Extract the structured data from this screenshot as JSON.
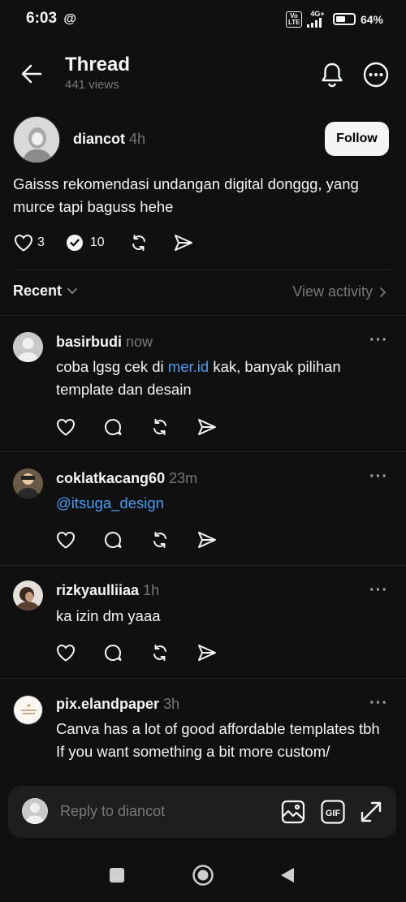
{
  "status": {
    "time": "6:03",
    "network": "4G+",
    "volte": "Vo LTE",
    "battery": "64%",
    "battery_level": 0.64
  },
  "header": {
    "title": "Thread",
    "views": "441 views"
  },
  "post": {
    "username": "diancot",
    "time": "4h",
    "follow_label": "Follow",
    "text": "Gaisss rekomendasi undangan digital donggg, yang murce tapi baguss hehe",
    "likes": "3",
    "replies": "10"
  },
  "section": {
    "sort_label": "Recent",
    "activity_label": "View activity"
  },
  "replies": [
    {
      "username": "basirbudi",
      "time": "now",
      "text_before": "coba lgsg cek di ",
      "link": "mer.id",
      "text_after": " kak, banyak pilihan template dan desain"
    },
    {
      "username": "coklatkacang60",
      "time": "23m",
      "link": "@itsuga_design"
    },
    {
      "username": "rizkyaulliiaa",
      "time": "1h",
      "text": "ka izin dm yaaa"
    },
    {
      "username": "pix.elandpaper",
      "time": "3h",
      "text": "Canva has a lot of good affordable templates tbh",
      "text2": "If you want something a bit more custom/"
    }
  ],
  "composer": {
    "placeholder": "Reply to diancot"
  },
  "colors": {
    "background": "#101010",
    "text": "#f3f5f7",
    "muted": "#777777",
    "link": "#4a9bf2"
  },
  "icons": [
    "back-arrow-icon",
    "bell-icon",
    "more-icon",
    "heart-icon",
    "verified-reply-icon",
    "repost-icon",
    "share-icon",
    "chevron-down-icon",
    "chevron-right-icon",
    "image-icon",
    "gif-icon",
    "expand-icon",
    "nav-square-icon",
    "nav-home-icon",
    "nav-back-icon"
  ]
}
